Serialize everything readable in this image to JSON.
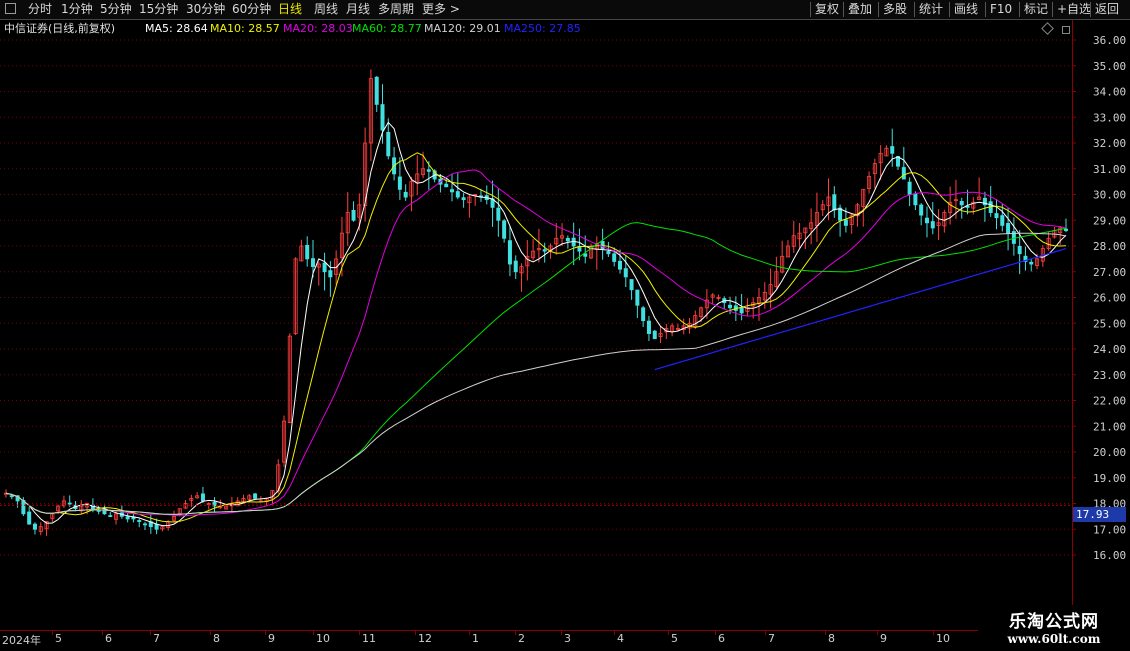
{
  "toolbar": {
    "periods": [
      "分时",
      "1分钟",
      "5分钟",
      "15分钟",
      "30分钟",
      "60分钟",
      "日线",
      "周线",
      "月线",
      "多周期",
      "更多 >"
    ],
    "active": "日线",
    "right": [
      "复权",
      "叠加",
      "多股",
      "统计",
      "画线",
      "F10",
      "标记",
      "+自选",
      "返回"
    ]
  },
  "title": "中信证券(日线,前复权)",
  "ma_legend": [
    {
      "label": "MA5: 28.64",
      "color": "#ffffff"
    },
    {
      "label": "MA10: 28.57",
      "color": "#f0f000"
    },
    {
      "label": "MA20: 28.03",
      "color": "#e000e0"
    },
    {
      "label": "MA60: 28.77",
      "color": "#00e000"
    },
    {
      "label": "MA120: 29.01",
      "color": "#d0d0d0"
    },
    {
      "label": "MA250: 27.85",
      "color": "#2222ff"
    }
  ],
  "last_price": "17.93",
  "watermark": {
    "line1": "乐淘公式网",
    "line2": "www.60lt.com"
  },
  "colors": {
    "up": "#ff4040",
    "down": "#40e0e0",
    "grid": "#7a0000"
  },
  "chart_data": {
    "type": "candlestick",
    "y_ticks": [
      "16.00",
      "17.00",
      "18.00",
      "19.00",
      "20.00",
      "21.00",
      "22.00",
      "23.00",
      "24.00",
      "25.00",
      "26.00",
      "27.00",
      "28.00",
      "29.00",
      "30.00",
      "31.00",
      "32.00",
      "33.00",
      "34.00",
      "35.00",
      "36.00"
    ],
    "ylim": [
      15.5,
      36.3
    ],
    "x_labels": [
      "2024年",
      "5",
      "6",
      "7",
      "8",
      "9",
      "10",
      "11",
      "12",
      "1",
      "2",
      "3",
      "4",
      "5",
      "6",
      "7",
      "8",
      "9",
      "10"
    ],
    "closes": [
      18.4,
      18.3,
      18.1,
      17.6,
      17.2,
      17.0,
      17.1,
      17.3,
      17.6,
      17.9,
      18.1,
      18.0,
      17.8,
      17.9,
      18.0,
      17.8,
      17.7,
      17.6,
      17.5,
      17.6,
      17.5,
      17.4,
      17.4,
      17.3,
      17.2,
      17.1,
      17.0,
      17.1,
      17.3,
      17.5,
      17.8,
      18.0,
      18.2,
      18.3,
      18.1,
      18.0,
      17.9,
      17.9,
      17.9,
      18.0,
      18.1,
      18.2,
      18.3,
      18.2,
      18.1,
      18.2,
      18.5,
      19.5,
      21.2,
      24.5,
      27.5,
      28.0,
      27.5,
      27.2,
      27.3,
      27.0,
      26.8,
      27.5,
      28.5,
      29.3,
      29.0,
      29.6,
      32.0,
      34.5,
      33.5,
      32.5,
      31.5,
      30.8,
      30.2,
      29.9,
      30.5,
      30.8,
      31.0,
      30.9,
      30.6,
      30.4,
      30.3,
      30.1,
      29.9,
      29.8,
      29.9,
      30.0,
      29.9,
      29.8,
      29.5,
      29.0,
      28.3,
      27.3,
      27.0,
      27.2,
      27.6,
      27.8,
      27.9,
      27.8,
      28.0,
      28.3,
      28.4,
      28.2,
      28.0,
      27.8,
      27.6,
      27.9,
      28.1,
      27.9,
      27.7,
      27.4,
      27.1,
      26.8,
      26.3,
      25.7,
      25.1,
      24.6,
      24.4,
      24.6,
      24.8,
      24.9,
      24.8,
      24.9,
      25.0,
      25.3,
      25.6,
      25.9,
      26.1,
      26.0,
      25.8,
      25.6,
      25.5,
      25.4,
      25.6,
      25.8,
      26.0,
      26.2,
      26.5,
      27.0,
      27.6,
      28.0,
      28.4,
      28.5,
      28.7,
      28.9,
      29.3,
      29.6,
      29.9,
      29.4,
      29.0,
      28.8,
      29.2,
      29.6,
      30.2,
      30.7,
      31.2,
      31.6,
      31.8,
      31.6,
      31.1,
      30.6,
      30.0,
      29.6,
      29.2,
      28.9,
      28.7,
      28.9,
      29.3,
      29.7,
      29.8,
      29.6,
      29.5,
      29.7,
      29.9,
      29.6,
      29.3,
      29.1,
      28.8,
      28.5,
      28.1,
      27.7,
      27.4,
      27.3,
      27.5,
      27.9,
      28.3,
      28.6,
      28.7,
      28.6
    ],
    "ma_series": [
      "MA5",
      "MA10",
      "MA20",
      "MA60",
      "MA120",
      "MA250"
    ]
  }
}
